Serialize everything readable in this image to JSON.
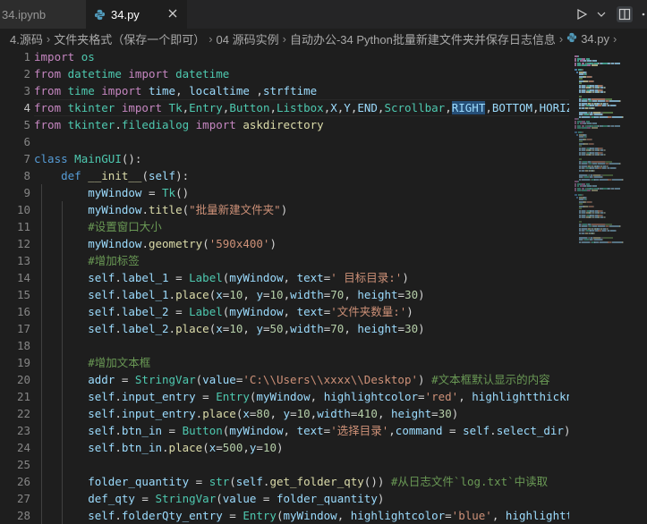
{
  "tabs": [
    {
      "label": "34.ipynb",
      "active": false
    },
    {
      "label": "34.py",
      "active": true
    }
  ],
  "breadcrumb": [
    "4.源码",
    "文件夹格式（保存一个即可）",
    "04 源码实例",
    "自动办公-34 Python批量新建文件夹并保存日志信息",
    "34.py"
  ],
  "colors": {
    "editor_bg": "#1e1e1e",
    "tabbar_bg": "#252526",
    "keyword": "#c586c0",
    "string": "#ce9178",
    "comment": "#6a9955",
    "function": "#dcdcaa",
    "class": "#4ec9b0"
  },
  "icons": [
    "python-icon",
    "close-icon",
    "run-icon",
    "chevron-down-icon",
    "split-editor-icon",
    "more-icon"
  ],
  "current_line": 4,
  "lines": [
    {
      "n": "1",
      "t": [
        [
          "kw",
          "import"
        ],
        [
          "p",
          " "
        ],
        [
          "cls",
          "os"
        ]
      ]
    },
    {
      "n": "2",
      "t": [
        [
          "kw",
          "from"
        ],
        [
          "p",
          " "
        ],
        [
          "cls",
          "datetime"
        ],
        [
          "p",
          " "
        ],
        [
          "kw",
          "import"
        ],
        [
          "p",
          " "
        ],
        [
          "cls",
          "datetime"
        ]
      ]
    },
    {
      "n": "3",
      "t": [
        [
          "kw",
          "from"
        ],
        [
          "p",
          " "
        ],
        [
          "cls",
          "time"
        ],
        [
          "p",
          " "
        ],
        [
          "kw",
          "import"
        ],
        [
          "p",
          " "
        ],
        [
          "var",
          "time"
        ],
        [
          "p",
          ", "
        ],
        [
          "var",
          "localtime"
        ],
        [
          "p",
          " ,"
        ],
        [
          "var",
          "strftime"
        ]
      ]
    },
    {
      "n": "4",
      "t": [
        [
          "kw",
          "from"
        ],
        [
          "p",
          " "
        ],
        [
          "cls",
          "tkinter"
        ],
        [
          "p",
          " "
        ],
        [
          "kw",
          "import"
        ],
        [
          "p",
          " "
        ],
        [
          "cls",
          "Tk"
        ],
        [
          "p",
          ","
        ],
        [
          "cls",
          "Entry"
        ],
        [
          "p",
          ","
        ],
        [
          "cls",
          "Button"
        ],
        [
          "p",
          ","
        ],
        [
          "cls",
          "Listbox"
        ],
        [
          "p",
          ","
        ],
        [
          "var",
          "X"
        ],
        [
          "p",
          ","
        ],
        [
          "var",
          "Y"
        ],
        [
          "p",
          ","
        ],
        [
          "var",
          "END"
        ],
        [
          "p",
          ","
        ],
        [
          "cls",
          "Scrollbar"
        ],
        [
          "p",
          ","
        ],
        [
          "sel",
          "RIGHT"
        ],
        [
          "p",
          ","
        ],
        [
          "var",
          "BOTTOM"
        ],
        [
          "p",
          ","
        ],
        [
          "var",
          "HORIZONTAL"
        ]
      ]
    },
    {
      "n": "5",
      "t": [
        [
          "kw",
          "from"
        ],
        [
          "p",
          " "
        ],
        [
          "cls",
          "tkinter"
        ],
        [
          "p",
          "."
        ],
        [
          "cls",
          "filedialog"
        ],
        [
          "p",
          " "
        ],
        [
          "kw",
          "import"
        ],
        [
          "p",
          " "
        ],
        [
          "fn",
          "askdirectory"
        ]
      ]
    },
    {
      "n": "6",
      "t": []
    },
    {
      "n": "7",
      "t": [
        [
          "kw2",
          "class"
        ],
        [
          "p",
          " "
        ],
        [
          "cls",
          "MainGUI"
        ],
        [
          "p",
          "():"
        ]
      ]
    },
    {
      "n": "8",
      "t": [
        [
          "p",
          "    "
        ],
        [
          "kw2",
          "def"
        ],
        [
          "p",
          " "
        ],
        [
          "fn",
          "__init__"
        ],
        [
          "p",
          "("
        ],
        [
          "var",
          "self"
        ],
        [
          "p",
          "):"
        ]
      ]
    },
    {
      "n": "9",
      "t": [
        [
          "p",
          "        "
        ],
        [
          "var",
          "myWindow"
        ],
        [
          "p",
          " = "
        ],
        [
          "cls",
          "Tk"
        ],
        [
          "p",
          "()"
        ]
      ]
    },
    {
      "n": "10",
      "t": [
        [
          "p",
          "        "
        ],
        [
          "var",
          "myWindow"
        ],
        [
          "p",
          "."
        ],
        [
          "fn",
          "title"
        ],
        [
          "p",
          "("
        ],
        [
          "str",
          "\"批量新建文件夹\""
        ],
        [
          "p",
          ")"
        ]
      ]
    },
    {
      "n": "11",
      "t": [
        [
          "p",
          "        "
        ],
        [
          "cm",
          "#设置窗口大小"
        ]
      ]
    },
    {
      "n": "12",
      "t": [
        [
          "p",
          "        "
        ],
        [
          "var",
          "myWindow"
        ],
        [
          "p",
          "."
        ],
        [
          "fn",
          "geometry"
        ],
        [
          "p",
          "("
        ],
        [
          "str",
          "'590x400'"
        ],
        [
          "p",
          ")"
        ]
      ]
    },
    {
      "n": "13",
      "t": [
        [
          "p",
          "        "
        ],
        [
          "cm",
          "#增加标签"
        ]
      ]
    },
    {
      "n": "14",
      "t": [
        [
          "p",
          "        "
        ],
        [
          "var",
          "self"
        ],
        [
          "p",
          "."
        ],
        [
          "var",
          "label_1"
        ],
        [
          "p",
          " = "
        ],
        [
          "cls",
          "Label"
        ],
        [
          "p",
          "("
        ],
        [
          "var",
          "myWindow"
        ],
        [
          "p",
          ", "
        ],
        [
          "var",
          "text"
        ],
        [
          "p",
          "="
        ],
        [
          "str",
          "' 目标目录:'"
        ],
        [
          "p",
          ")"
        ]
      ]
    },
    {
      "n": "15",
      "t": [
        [
          "p",
          "        "
        ],
        [
          "var",
          "self"
        ],
        [
          "p",
          "."
        ],
        [
          "var",
          "label_1"
        ],
        [
          "p",
          "."
        ],
        [
          "fn",
          "place"
        ],
        [
          "p",
          "("
        ],
        [
          "var",
          "x"
        ],
        [
          "p",
          "="
        ],
        [
          "num",
          "10"
        ],
        [
          "p",
          ", "
        ],
        [
          "var",
          "y"
        ],
        [
          "p",
          "="
        ],
        [
          "num",
          "10"
        ],
        [
          "p",
          ","
        ],
        [
          "var",
          "width"
        ],
        [
          "p",
          "="
        ],
        [
          "num",
          "70"
        ],
        [
          "p",
          ", "
        ],
        [
          "var",
          "height"
        ],
        [
          "p",
          "="
        ],
        [
          "num",
          "30"
        ],
        [
          "p",
          ")"
        ]
      ]
    },
    {
      "n": "16",
      "t": [
        [
          "p",
          "        "
        ],
        [
          "var",
          "self"
        ],
        [
          "p",
          "."
        ],
        [
          "var",
          "label_2"
        ],
        [
          "p",
          " = "
        ],
        [
          "cls",
          "Label"
        ],
        [
          "p",
          "("
        ],
        [
          "var",
          "myWindow"
        ],
        [
          "p",
          ", "
        ],
        [
          "var",
          "text"
        ],
        [
          "p",
          "="
        ],
        [
          "str",
          "'文件夹数量:'"
        ],
        [
          "p",
          ")"
        ]
      ]
    },
    {
      "n": "17",
      "t": [
        [
          "p",
          "        "
        ],
        [
          "var",
          "self"
        ],
        [
          "p",
          "."
        ],
        [
          "var",
          "label_2"
        ],
        [
          "p",
          "."
        ],
        [
          "fn",
          "place"
        ],
        [
          "p",
          "("
        ],
        [
          "var",
          "x"
        ],
        [
          "p",
          "="
        ],
        [
          "num",
          "10"
        ],
        [
          "p",
          ", "
        ],
        [
          "var",
          "y"
        ],
        [
          "p",
          "="
        ],
        [
          "num",
          "50"
        ],
        [
          "p",
          ","
        ],
        [
          "var",
          "width"
        ],
        [
          "p",
          "="
        ],
        [
          "num",
          "70"
        ],
        [
          "p",
          ", "
        ],
        [
          "var",
          "height"
        ],
        [
          "p",
          "="
        ],
        [
          "num",
          "30"
        ],
        [
          "p",
          ")"
        ]
      ]
    },
    {
      "n": "18",
      "t": []
    },
    {
      "n": "19",
      "t": [
        [
          "p",
          "        "
        ],
        [
          "cm",
          "#增加文本框"
        ]
      ]
    },
    {
      "n": "20",
      "t": [
        [
          "p",
          "        "
        ],
        [
          "var",
          "addr"
        ],
        [
          "p",
          " = "
        ],
        [
          "cls",
          "StringVar"
        ],
        [
          "p",
          "("
        ],
        [
          "var",
          "value"
        ],
        [
          "p",
          "="
        ],
        [
          "str",
          "'C:\\\\Users\\\\xxxx\\\\Desktop'"
        ],
        [
          "p",
          ") "
        ],
        [
          "cm",
          "#文本框默认显示的内容"
        ]
      ]
    },
    {
      "n": "21",
      "t": [
        [
          "p",
          "        "
        ],
        [
          "var",
          "self"
        ],
        [
          "p",
          "."
        ],
        [
          "var",
          "input_entry"
        ],
        [
          "p",
          " = "
        ],
        [
          "cls",
          "Entry"
        ],
        [
          "p",
          "("
        ],
        [
          "var",
          "myWindow"
        ],
        [
          "p",
          ", "
        ],
        [
          "var",
          "highlightcolor"
        ],
        [
          "p",
          "="
        ],
        [
          "str",
          "'red'"
        ],
        [
          "p",
          ", "
        ],
        [
          "var",
          "highlightthickness"
        ],
        [
          "p",
          "="
        ],
        [
          "num",
          "1"
        ],
        [
          "p",
          ")"
        ]
      ]
    },
    {
      "n": "22",
      "t": [
        [
          "p",
          "        "
        ],
        [
          "var",
          "self"
        ],
        [
          "p",
          "."
        ],
        [
          "var",
          "input_entry"
        ],
        [
          "p",
          "."
        ],
        [
          "fn",
          "place"
        ],
        [
          "p",
          "("
        ],
        [
          "var",
          "x"
        ],
        [
          "p",
          "="
        ],
        [
          "num",
          "80"
        ],
        [
          "p",
          ", "
        ],
        [
          "var",
          "y"
        ],
        [
          "p",
          "="
        ],
        [
          "num",
          "10"
        ],
        [
          "p",
          ","
        ],
        [
          "var",
          "width"
        ],
        [
          "p",
          "="
        ],
        [
          "num",
          "410"
        ],
        [
          "p",
          ", "
        ],
        [
          "var",
          "height"
        ],
        [
          "p",
          "="
        ],
        [
          "num",
          "30"
        ],
        [
          "p",
          ")"
        ]
      ]
    },
    {
      "n": "23",
      "t": [
        [
          "p",
          "        "
        ],
        [
          "var",
          "self"
        ],
        [
          "p",
          "."
        ],
        [
          "var",
          "btn_in"
        ],
        [
          "p",
          " = "
        ],
        [
          "cls",
          "Button"
        ],
        [
          "p",
          "("
        ],
        [
          "var",
          "myWindow"
        ],
        [
          "p",
          ", "
        ],
        [
          "var",
          "text"
        ],
        [
          "p",
          "="
        ],
        [
          "str",
          "'选择目录'"
        ],
        [
          "p",
          ","
        ],
        [
          "var",
          "command"
        ],
        [
          "p",
          " = "
        ],
        [
          "var",
          "self"
        ],
        [
          "p",
          "."
        ],
        [
          "var",
          "select_dir"
        ],
        [
          "p",
          ")"
        ]
      ]
    },
    {
      "n": "24",
      "t": [
        [
          "p",
          "        "
        ],
        [
          "var",
          "self"
        ],
        [
          "p",
          "."
        ],
        [
          "var",
          "btn_in"
        ],
        [
          "p",
          "."
        ],
        [
          "fn",
          "place"
        ],
        [
          "p",
          "("
        ],
        [
          "var",
          "x"
        ],
        [
          "p",
          "="
        ],
        [
          "num",
          "500"
        ],
        [
          "p",
          ","
        ],
        [
          "var",
          "y"
        ],
        [
          "p",
          "="
        ],
        [
          "num",
          "10"
        ],
        [
          "p",
          ")"
        ]
      ]
    },
    {
      "n": "25",
      "t": []
    },
    {
      "n": "26",
      "t": [
        [
          "p",
          "        "
        ],
        [
          "var",
          "folder_quantity"
        ],
        [
          "p",
          " = "
        ],
        [
          "cls",
          "str"
        ],
        [
          "p",
          "("
        ],
        [
          "var",
          "self"
        ],
        [
          "p",
          "."
        ],
        [
          "fn",
          "get_folder_qty"
        ],
        [
          "p",
          "()) "
        ],
        [
          "cm",
          "#从日志文件`log.txt`中读取"
        ]
      ]
    },
    {
      "n": "27",
      "t": [
        [
          "p",
          "        "
        ],
        [
          "var",
          "def_qty"
        ],
        [
          "p",
          " = "
        ],
        [
          "cls",
          "StringVar"
        ],
        [
          "p",
          "("
        ],
        [
          "var",
          "value"
        ],
        [
          "p",
          " = "
        ],
        [
          "var",
          "folder_quantity"
        ],
        [
          "p",
          ")"
        ]
      ]
    },
    {
      "n": "28",
      "t": [
        [
          "p",
          "        "
        ],
        [
          "var",
          "self"
        ],
        [
          "p",
          "."
        ],
        [
          "var",
          "folderQty_entry"
        ],
        [
          "p",
          " = "
        ],
        [
          "cls",
          "Entry"
        ],
        [
          "p",
          "("
        ],
        [
          "var",
          "myWindow"
        ],
        [
          "p",
          ", "
        ],
        [
          "var",
          "highlightcolor"
        ],
        [
          "p",
          "="
        ],
        [
          "str",
          "'blue'"
        ],
        [
          "p",
          ", "
        ],
        [
          "var",
          "highlightthickness"
        ],
        [
          "p",
          "="
        ],
        [
          "num",
          "1"
        ],
        [
          "p",
          ")"
        ]
      ]
    }
  ]
}
